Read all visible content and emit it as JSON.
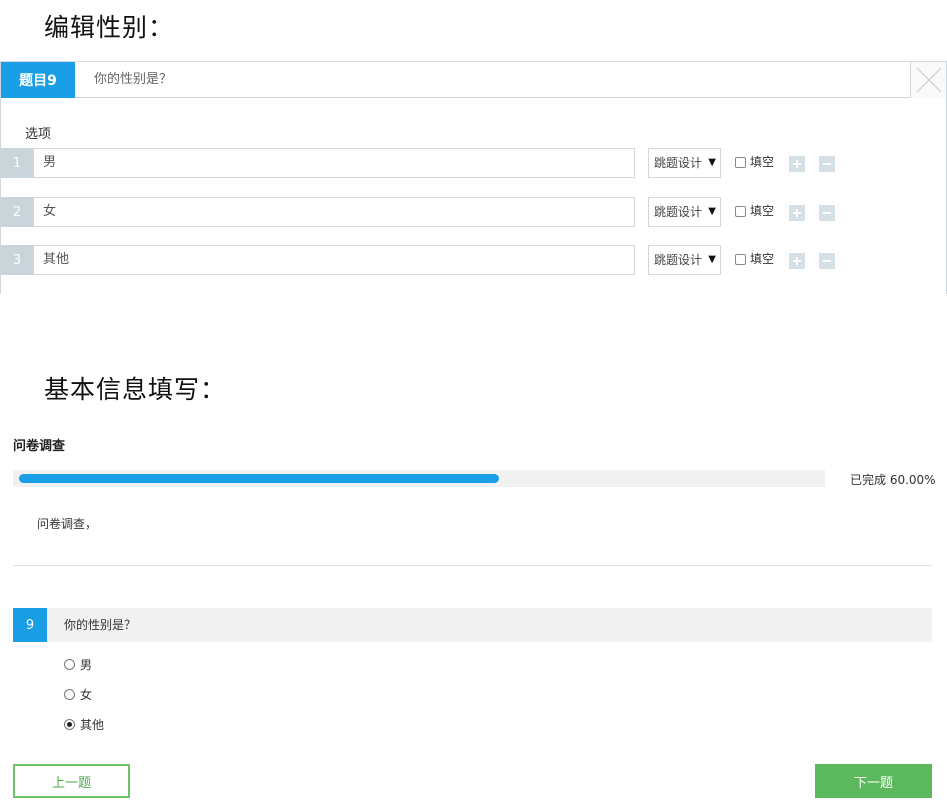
{
  "headings": {
    "edit": "编辑性别：",
    "basic": "基本信息填写："
  },
  "editor": {
    "question_badge": "题目9",
    "question_title": "你的性别是？",
    "options_label": "选项",
    "fill_label": "填空",
    "jump_label": "跳题设计",
    "options": [
      {
        "num": "1",
        "text": "男"
      },
      {
        "num": "2",
        "text": "女"
      },
      {
        "num": "3",
        "text": "其他"
      }
    ]
  },
  "survey": {
    "title": "问卷调查",
    "progress_text": "已完成 60.00%",
    "progress_percent": 60,
    "description": "问卷调查，",
    "question_number": "9",
    "question_text": "你的性别是？",
    "choices": [
      {
        "label": "男",
        "checked": false
      },
      {
        "label": "女",
        "checked": false
      },
      {
        "label": "其他",
        "checked": true
      }
    ],
    "prev_label": "上一题",
    "next_label": "下一题"
  },
  "colors": {
    "accent_blue": "#1a9ee6",
    "accent_green": "#5cb85c"
  }
}
